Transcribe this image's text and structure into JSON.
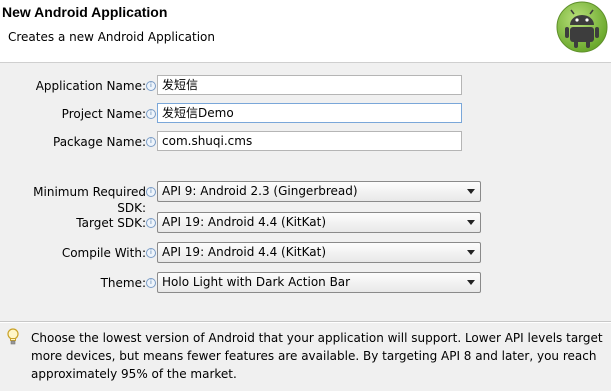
{
  "header": {
    "title": "New Android Application",
    "subtitle": "Creates a new Android Application",
    "logo_icon": "android-logo-icon"
  },
  "form": {
    "application_name": {
      "label": "Application Name:",
      "value": "发短信"
    },
    "project_name": {
      "label": "Project Name:",
      "value": "发短信Demo"
    },
    "package_name": {
      "label": "Package Name:",
      "value": "com.shuqi.cms"
    },
    "min_sdk": {
      "label": "Minimum Required SDK:",
      "value": "API 9: Android 2.3 (Gingerbread)"
    },
    "target_sdk": {
      "label": "Target SDK:",
      "value": "API 19: Android 4.4 (KitKat)"
    },
    "compile_with": {
      "label": "Compile With:",
      "value": "API 19: Android 4.4 (KitKat)"
    },
    "theme": {
      "label": "Theme:",
      "value": "Holo Light with Dark Action Bar"
    },
    "info_icon": "info-icon"
  },
  "help": {
    "icon": "lightbulb-icon",
    "text": "Choose the lowest version of Android that your application will support. Lower API levels target more devices, but means fewer features are available. By targeting API 8 and later, you reach approximately 95% of the market."
  },
  "colors": {
    "logo_green": "#8cc63f",
    "input_focus_border": "#7aa7d9"
  }
}
